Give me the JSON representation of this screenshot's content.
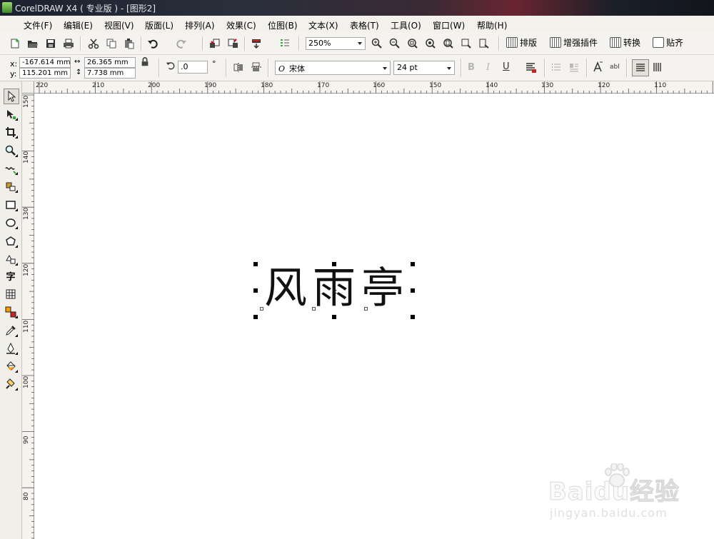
{
  "window": {
    "title": "CorelDRAW X4 ( 专业版 ) - [图形2]"
  },
  "menubar": {
    "items": [
      "文件(F)",
      "编辑(E)",
      "视图(V)",
      "版面(L)",
      "排列(A)",
      "效果(C)",
      "位图(B)",
      "文本(X)",
      "表格(T)",
      "工具(O)",
      "窗口(W)",
      "帮助(H)"
    ]
  },
  "toolbar": {
    "zoom_level": "250%",
    "plugins": [
      "排版",
      "增强插件",
      "转换",
      "贴齐"
    ]
  },
  "property_bar": {
    "x_label": "x:",
    "y_label": "y:",
    "x_value": "-167.614 mm",
    "y_value": "115.201 mm",
    "width_value": "26.365 mm",
    "height_value": "7.738 mm",
    "rotation_value": ".0",
    "rotation_unit": "°",
    "font_name": "宋体",
    "font_size": "24 pt"
  },
  "rulers": {
    "horizontal_labels": [
      "220",
      "210",
      "200",
      "190",
      "180",
      "170",
      "160",
      "150",
      "140",
      "130",
      "120",
      "110"
    ],
    "vertical_labels": [
      "150",
      "140",
      "130",
      "120",
      "110",
      "100",
      "90",
      "80"
    ]
  },
  "canvas": {
    "selected_text": "风雨亭",
    "center_marker": "×"
  },
  "watermark": {
    "brand": "Baidu经验",
    "url": "jingyan.baidu.com"
  },
  "colors": {
    "menubar_bg": "#f3f1ec",
    "toolbar_bg": "#f5f3ef",
    "canvas_bg": "#ffffff"
  }
}
